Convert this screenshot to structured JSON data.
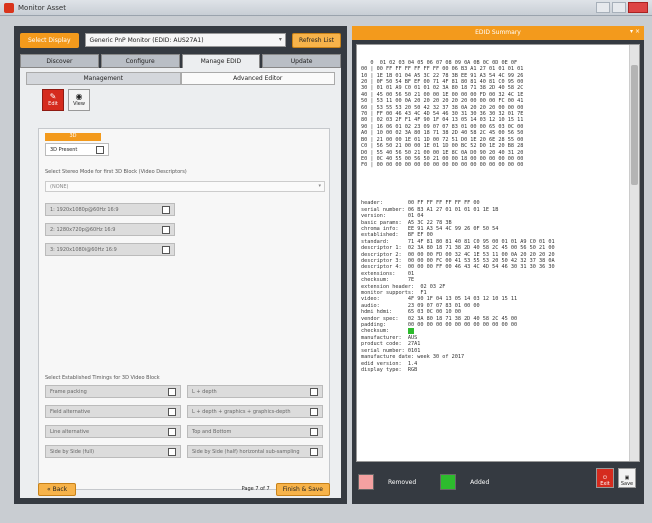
{
  "window": {
    "title": "Monitor Asset"
  },
  "left": {
    "device_label": "Select Display",
    "device_value": "Generic PnP Monitor (EDID: AUS27A1)",
    "refresh_label": "Refresh List",
    "tabs": [
      "Discover",
      "Configure",
      "Manage EDID",
      "Update"
    ],
    "subtabs": [
      "Management",
      "Advanced Editor"
    ],
    "icons": [
      {
        "label": "Edit"
      },
      {
        "label": "View"
      }
    ],
    "section_label": "3D",
    "row_label": "3D Present",
    "desc_label": "Select Stereo Mode for first 3D Block (Video Descriptors)",
    "desc_select_value": "(NONE)",
    "options": [
      "1: 1920x1080p@60Hz 16:9",
      "2: 1280x720p@60Hz 16:9",
      "3: 1920x1080i@60Hz 16:9"
    ],
    "est_label": "Select Established Timings for 3D Video Block",
    "est_items": [
      [
        "Frame packing",
        "L + depth"
      ],
      [
        "Field alternative",
        "L + depth + graphics + graphics-depth"
      ],
      [
        "Line alternative",
        "Top and Bottom"
      ],
      [
        "Side by Side (full)",
        "Side by Side (half) horizontal sub-sampling"
      ]
    ],
    "back_label": "Back",
    "page_text": "Page 7 of 7",
    "finish_label": "Finish & Save"
  },
  "right": {
    "header": "EDID Summary",
    "hex_rows": [
      "   0  01 02 03 04 05 06 07 08 09 0A 0B 0C 0D 0E 0F",
      "00 | 00 FF FF FF FF FF FF 00 06 B3 A1 27 01 01 01 01",
      "10 | 1E 1B 01 04 A5 3C 22 78 3B EE 91 A3 54 4C 99 26",
      "20 | 0F 50 54 BF EF 00 71 4F 81 80 81 40 81 C0 95 00",
      "30 | 01 01 A9 C0 01 01 02 3A 80 18 71 38 2D 40 58 2C",
      "40 | 45 00 56 50 21 00 00 1E 00 00 00 FD 00 32 4C 1E",
      "50 | 53 11 00 0A 20 20 20 20 20 20 00 00 00 FC 00 41",
      "60 | 53 55 53 20 50 42 32 37 38 0A 20 20 20 00 00 00",
      "70 | FF 00 46 43 4C 4D 54 46 30 31 30 36 30 32 01 7E",
      "80 | 02 03 2F F1 4F 90 1F 04 13 05 14 03 12 10 15 11",
      "90 | 16 06 01 02 23 09 07 07 83 01 00 00 65 03 0C 00",
      "A0 | 10 00 02 3A 80 18 71 38 2D 40 58 2C 45 00 56 50",
      "B0 | 21 00 00 1E 01 1D 00 72 51 D0 1E 20 6E 28 55 00",
      "C0 | 56 50 21 00 00 1E 01 1D 00 BC 52 D0 1E 20 B8 28",
      "D0 | 55 40 56 50 21 00 00 1E 8C 0A D0 90 20 40 31 20",
      "E0 | 0C 40 55 00 56 50 21 00 00 18 00 00 00 00 00 00",
      "F0 | 00 00 00 00 00 00 00 00 00 00 00 00 00 00 00 00"
    ],
    "details": [
      "header:        00 FF FF FF FF FF FF 00",
      "serial number: 06 B3 A1 27 01 01 01 01 1E 1B",
      "version:       01 04",
      "basic params:  A5 3C 22 78 3B",
      "chroma info:   EE 91 A3 54 4C 99 26 0F 50 54",
      "established:   BF EF 00",
      "standard:      71 4F 81 80 81 40 81 C0 95 00 01 01 A9 C0 01 01",
      "descriptor 1:  02 3A 80 18 71 38 2D 40 58 2C 45 00 56 50 21 00",
      "descriptor 2:  00 00 00 FD 00 32 4C 1E 53 11 00 0A 20 20 20 20",
      "descriptor 3:  00 00 00 FC 00 41 53 55 53 20 50 42 32 37 38 0A",
      "descriptor 4:  00 00 00 FF 00 46 43 4C 4D 54 46 30 31 30 36 30",
      "extensions:    01",
      "checksum:      7E",
      "",
      "extension header:  02 03 2F",
      "monitor supports:  F1",
      "video:         4F 90 1F 04 13 05 14 03 12 10 15 11",
      "audio:         23 09 07 07 83 01 00 00",
      "hdmi hdmi:     65 03 0C 00 10 00",
      "vendor spec:   02 3A 80 18 71 38 2D 40 58 2C 45 00",
      "padding:       00 00 00 00 00 00 00 00 00 00 00 00",
      "checksum:      ",
      "",
      "manufacturer:  AUS",
      "product code:  27A1",
      "serial number: 0101",
      "manufacture date: week 30 of 2017",
      "edid version:  1.4",
      "display type:  RGB"
    ],
    "legend": [
      {
        "label": "Removed",
        "color": "#f4a1a1"
      },
      {
        "label": "Added",
        "color": "#2dbb2d"
      }
    ],
    "btns": [
      {
        "label": "Exit"
      },
      {
        "label": "Save"
      }
    ]
  }
}
